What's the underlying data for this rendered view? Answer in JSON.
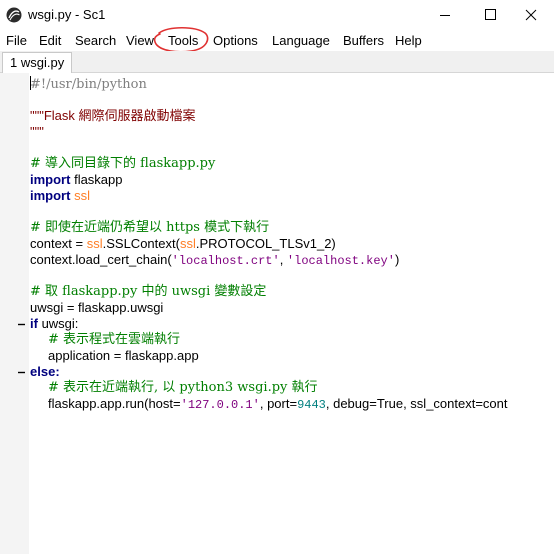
{
  "window": {
    "title": "wsgi.py - Sc1",
    "controls": {
      "minimize": "minimize-icon",
      "maximize": "maximize-icon",
      "close": "close-icon"
    }
  },
  "menu": {
    "items": [
      "File",
      "Edit",
      "Search",
      "View",
      "Tools",
      "Options",
      "Language",
      "Buffers",
      "Help"
    ],
    "circled_item": "Tools",
    "annotation_color": "#e03131"
  },
  "tabs": [
    {
      "label": "1 wsgi.py",
      "active": true
    }
  ],
  "editor": {
    "lines": {
      "l1": "#!/usr/bin/python",
      "l2": "\"\"\"Flask 網際伺服器啟動檔案",
      "l3": "\"\"\"",
      "l4": "# 導入同目錄下的 flaskapp.py",
      "l5_kw": "import",
      "l5_mod": "flaskapp",
      "l6_kw": "import",
      "l6_mod": "ssl",
      "l7": "# 即使在近端仍希望以 https 模式下執行",
      "l8_a": "context = ",
      "l8_ssl1": "ssl",
      "l8_b": ".SSLContext(",
      "l8_ssl2": "ssl",
      "l8_c": ".PROTOCOL_TLSv1_2)",
      "l9_a": "context.load_cert_chain(",
      "l9_s1": "'localhost.crt'",
      "l9_b": ", ",
      "l9_s2": "'localhost.key'",
      "l9_c": ")",
      "l10": "# 取 flaskapp.py 中的 uwsgi 變數設定",
      "l11": "uwsgi = flaskapp.uwsgi",
      "l12_kw": "if",
      "l12_rest": " uwsgi:",
      "l13": "# 表示程式在雲端執行",
      "l14": "application = flaskapp.app",
      "l15_kw": "else",
      "l15_rest": ":",
      "l16": "# 表示在近端執行, 以 python3 wsgi.py 執行",
      "l17_a": "flaskapp.app.run(host=",
      "l17_s": "'127.0.0.1'",
      "l17_b": ", port=",
      "l17_n": "9443",
      "l17_c": ", debug=True, ssl_context=cont"
    },
    "colors": {
      "comment": "#007f00",
      "docstring": "#7f0000",
      "keyword": "#00007f",
      "string": "#7f007f",
      "number": "#007f7f",
      "highlight_ssl": "#ff7f27",
      "margin": "#f4f4f4"
    }
  }
}
